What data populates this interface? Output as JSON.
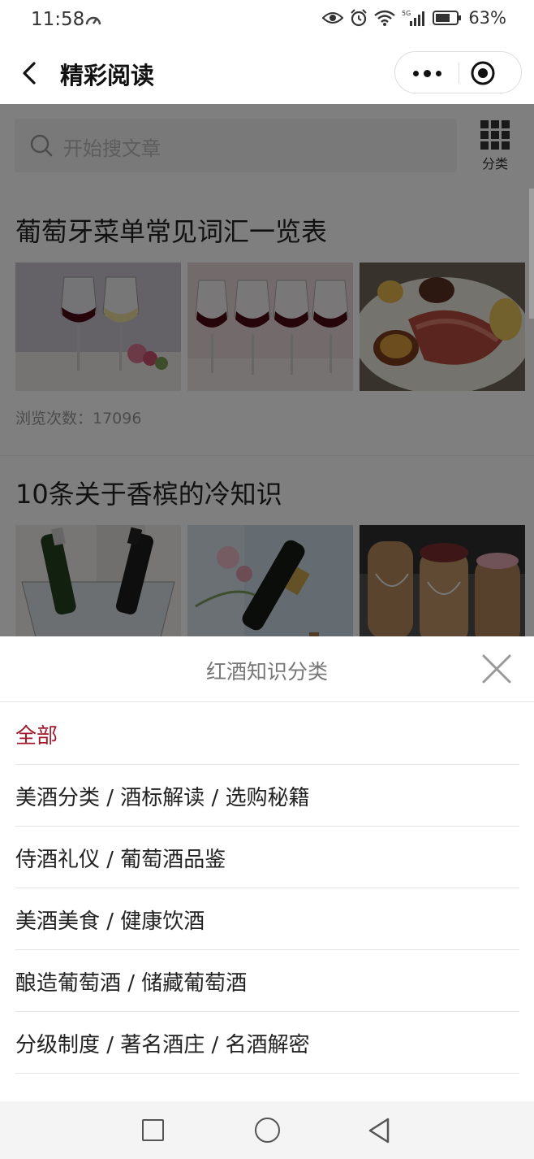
{
  "status_bar": {
    "time": "11:58",
    "battery": "63%",
    "network": "5G"
  },
  "nav": {
    "title": "精彩阅读"
  },
  "search": {
    "placeholder": "开始搜文章"
  },
  "category_button": {
    "label": "分类"
  },
  "articles": [
    {
      "title": "葡萄牙菜单常见词汇一览表",
      "views_label": "浏览次数：17096"
    },
    {
      "title": "10条关于香槟的冷知识"
    }
  ],
  "sheet": {
    "title": "红酒知识分类",
    "items": [
      {
        "label": "全部"
      },
      {
        "label": "美酒分类 / 酒标解读 / 选购秘籍"
      },
      {
        "label": "侍酒礼仪 / 葡萄酒品鉴"
      },
      {
        "label": "美酒美食 / 健康饮酒"
      },
      {
        "label": "酿造葡萄酒 / 储藏葡萄酒"
      },
      {
        "label": "分级制度 / 著名酒庄 / 名酒解密"
      }
    ],
    "active_index": 0
  },
  "colors": {
    "accent": "#a01a2c",
    "overlay": "rgba(0,0,0,0.5)",
    "sheet_bg": "#ffffff",
    "sys_nav_bg": "#f4f4f4"
  }
}
